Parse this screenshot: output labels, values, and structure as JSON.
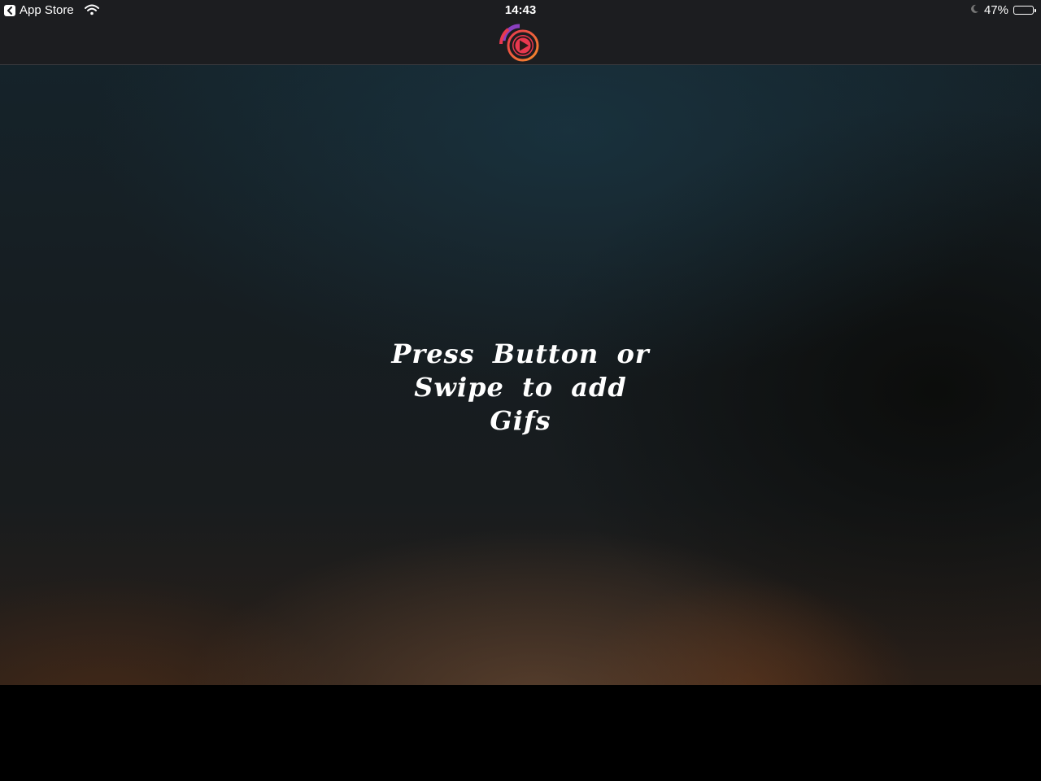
{
  "status_bar": {
    "back_app_label": "App Store",
    "time": "14:43",
    "battery_percent_text": "47%",
    "battery_level": 0.47,
    "icons": [
      "back-chevron-icon",
      "wifi-icon",
      "moon-icon",
      "battery-icon"
    ]
  },
  "header": {
    "logo_icon": "gif-play-logo-icon",
    "logo_colors": [
      "#e8384f",
      "#f58a2a",
      "#8a3fbf"
    ]
  },
  "main": {
    "message_line1": "Press Button or",
    "message_line2": "Swipe to add",
    "message_line3": "Gifs"
  }
}
